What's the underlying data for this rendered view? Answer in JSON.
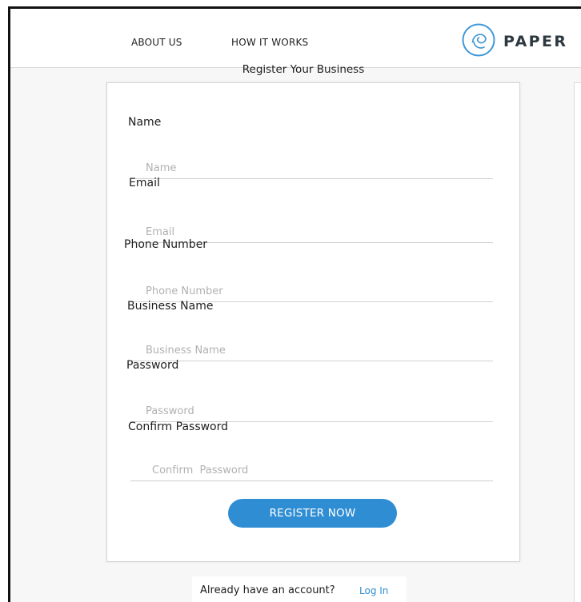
{
  "nav": {
    "about_label": "ABOUT US",
    "how_label": "HOW IT WORKS",
    "brand_text": "PAPER",
    "logo_icon": "paper-logo-icon"
  },
  "page": {
    "heading": "Register Your Business"
  },
  "form": {
    "fields": [
      {
        "label": "Name",
        "placeholder": "Name",
        "value": ""
      },
      {
        "label": "Email",
        "placeholder": "Email",
        "value": ""
      },
      {
        "label": "Phone Number",
        "placeholder": "Phone Number",
        "value": ""
      },
      {
        "label": "Business Name",
        "placeholder": "Business Name",
        "value": ""
      },
      {
        "label": "Password",
        "placeholder": "Password",
        "value": ""
      },
      {
        "label": "Confirm Password",
        "placeholder": "Confirm  Password",
        "value": ""
      }
    ],
    "submit_label": "REGISTER NOW"
  },
  "footer": {
    "prompt": "Already have an account?",
    "login_label": "Log In"
  },
  "colors": {
    "accent": "#2f8ed3",
    "text": "#1d1d1d",
    "placeholder": "#b1b1b1",
    "logo": "#2d3940"
  }
}
